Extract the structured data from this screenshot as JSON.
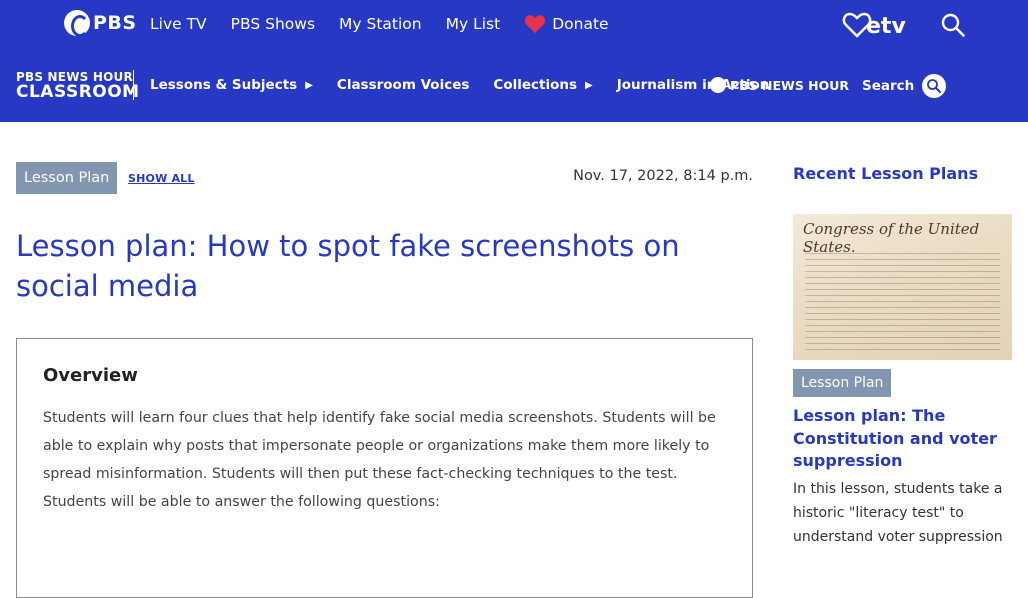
{
  "pbs": {
    "logo_text": "PBS",
    "nav": [
      "Live TV",
      "PBS Shows",
      "My Station",
      "My List"
    ],
    "donate_label": "Donate",
    "station_logo_text": "etv"
  },
  "classroom": {
    "logo_line1": "PBS NEWS HOUR",
    "logo_line2": "CLASSROOM",
    "nav": {
      "lessons": "Lessons & Subjects",
      "voices": "Classroom Voices",
      "collections": "Collections",
      "journalism": "Journalism in Action"
    },
    "newshour_logo": "PBS NEWS HOUR",
    "search_label": "Search"
  },
  "article": {
    "category": "Lesson Plan",
    "show_all": "SHOW ALL",
    "date": "Nov. 17, 2022, 8:14 p.m.",
    "title": "Lesson plan: How to spot fake screenshots on social media",
    "overview_heading": "Overview",
    "overview_text": "Students will learn four clues that help identify fake social media screenshots. Students will be able to explain why posts that impersonate people or organizations make them more likely to spread misinformation. Students will then put these fact-checking techniques to the test. Students will be able to answer the following questions:"
  },
  "sidebar": {
    "heading": "Recent Lesson Plans",
    "image_script": "Congress of the United States.",
    "item_category": "Lesson Plan",
    "item_title": "Lesson plan: The Constitution and voter suppression",
    "item_desc": "In this lesson, students take a historic \"literacy test\" to understand voter suppression"
  },
  "colors": {
    "brand_blue": "#2638c4",
    "badge_gray": "#8295b1",
    "donate_red": "#e8334a"
  }
}
